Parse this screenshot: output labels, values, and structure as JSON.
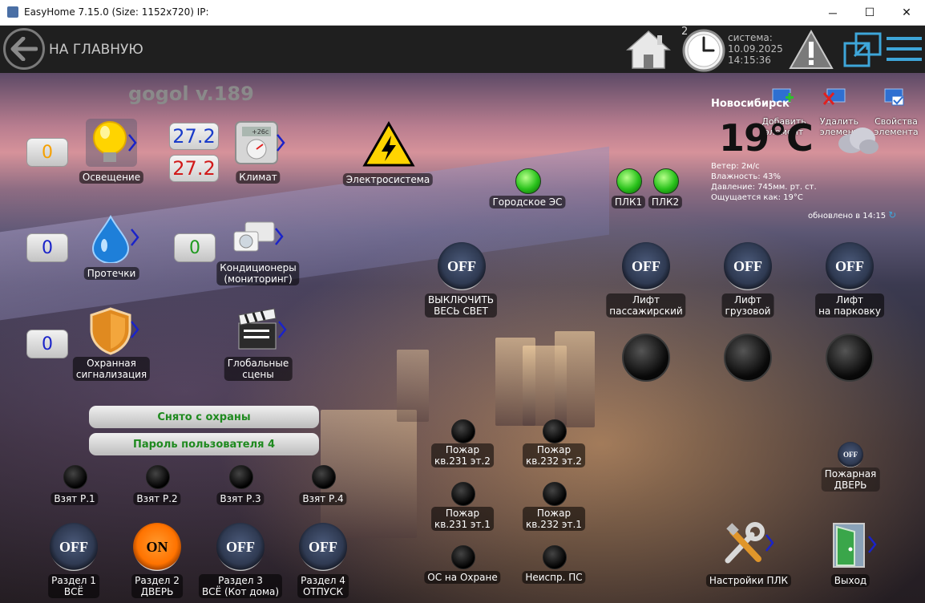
{
  "window": {
    "title": "EasyHome 7.15.0 (Size: 1152x720) IP:",
    "minimize": "─",
    "maximize": "☐",
    "close": "✕"
  },
  "topbar": {
    "home_label": "НА ГЛАВНУЮ",
    "clock_badge": "2",
    "system_label": "система:",
    "date": "10.09.2025",
    "time": "14:15:36"
  },
  "header": {
    "version": "gogol v.189"
  },
  "weather": {
    "city": "Новосибирск",
    "temperature": "19°C",
    "wind": "Ветер: 2м/с",
    "humidity": "Влажность: 43%",
    "pressure": "Давление: 745мм. рт. ст.",
    "feels_like": "Ощущается как: 19°C",
    "updated": "обновлено в 14:15"
  },
  "element_tools": {
    "add": "Добавить\nэлемент",
    "delete": "Удалить\nэлемент",
    "properties": "Свойства\nэлемента"
  },
  "categories": {
    "lighting": {
      "label": "Освещение",
      "count": "0"
    },
    "climate": {
      "label": "Климат",
      "temp_top": "27.2",
      "temp_bottom": "27.2",
      "thermostat": "+26c"
    },
    "electrical": {
      "label": "Электросистема"
    },
    "leaks": {
      "label": "Протечки",
      "count": "0"
    },
    "ac": {
      "label": "Кондиционеры\n(мониторинг)",
      "count": "0"
    },
    "security": {
      "label": "Охранная\nсигнализация",
      "count": "0"
    },
    "scenes": {
      "label": "Глобальные\nсцены"
    }
  },
  "power": {
    "city_grid": "Городское ЭС",
    "plc1": "ПЛК1",
    "plc2": "ПЛК2"
  },
  "switches": {
    "all_lights": {
      "state": "OFF",
      "label": "ВЫКЛЮЧИТЬ\nВЕСЬ СВЕТ"
    },
    "lift_passenger": {
      "state": "OFF",
      "label": "Лифт\nпассажирский"
    },
    "lift_freight": {
      "state": "OFF",
      "label": "Лифт\nгрузовой"
    },
    "lift_parking": {
      "state": "OFF",
      "label": "Лифт\nна парковку"
    },
    "fire_door": {
      "state": "OFF",
      "label": "Пожарная\nДВЕРЬ"
    }
  },
  "security_status": {
    "status": "Снято с охраны",
    "user": "Пароль пользователя 4"
  },
  "zones_armed": [
    "Взят Р.1",
    "Взят Р.2",
    "Взят Р.3",
    "Взят Р.4"
  ],
  "partitions": [
    {
      "state": "OFF",
      "label": "Раздел 1\nВСЁ"
    },
    {
      "state": "ON",
      "label": "Раздел 2\nДВЕРЬ"
    },
    {
      "state": "OFF",
      "label": "Раздел 3\nВСЁ (Кот дома)"
    },
    {
      "state": "OFF",
      "label": "Раздел 4\nОТПУСК"
    }
  ],
  "fire": {
    "f231_2": "Пожар\nкв.231 эт.2",
    "f232_2": "Пожар\nкв.232 эт.2",
    "f231_1": "Пожар\nкв.231 эт.1",
    "f232_1": "Пожар\nкв.232 эт.1",
    "armed": "ОС на Охране",
    "fault": "Неиспр. ПС"
  },
  "bottom": {
    "plc_settings": "Настройки ПЛК",
    "exit": "Выход"
  },
  "colors": {
    "topbar": "#1f1f1f",
    "on_button": "#ff7300",
    "status_green": "#1f8a1f",
    "counter_orange": "#f5a000",
    "counter_blue": "#1a23c9",
    "counter_green": "#1f9a1f",
    "temp_red": "#d11a1a",
    "temp_blue": "#1a3cc9"
  }
}
